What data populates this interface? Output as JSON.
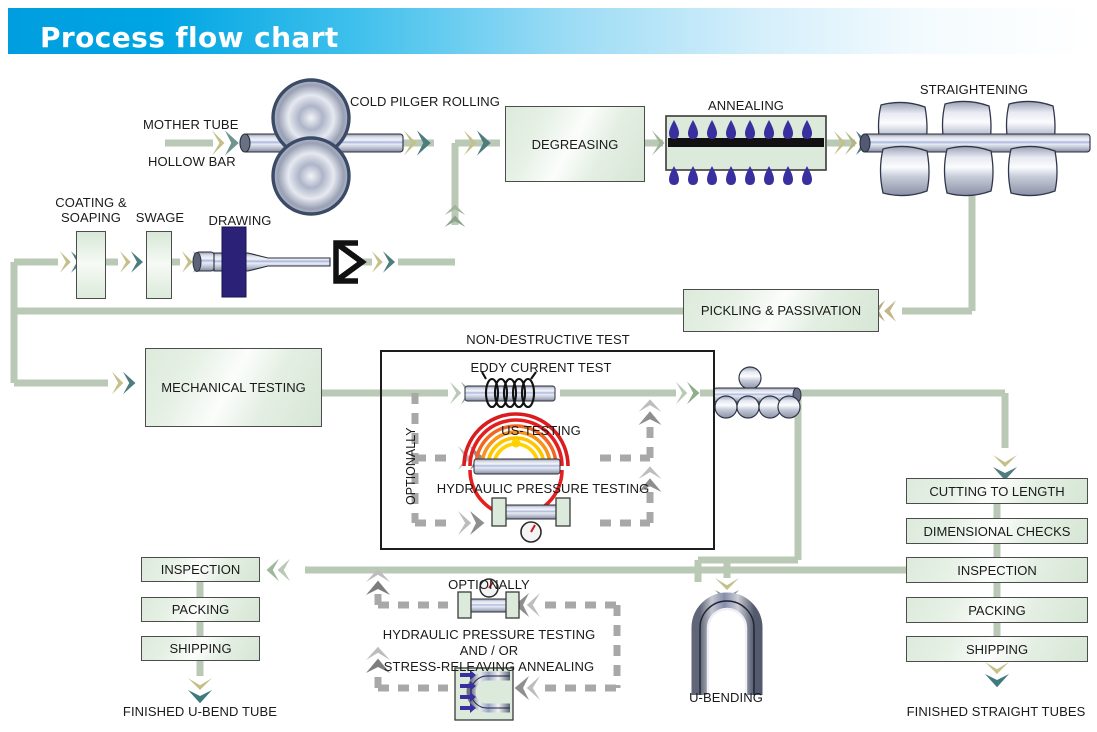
{
  "banner": {
    "title": "Process flow chart"
  },
  "colors": {
    "banner_start": "#009ee0",
    "flow_line": "#b9c9b5",
    "chevron_back": "#c3c08a",
    "chevron_front": "#6e958f",
    "box_border": "#4c4c4c",
    "box_fill": "#e4efe3",
    "dashed_gray": "#a8a8a8",
    "die_blue": "#2b2176",
    "flame_blue": "#3a2f9e",
    "us_wave_red": "#e41f20",
    "us_wave_orange": "#f6941d",
    "us_wave_yellow": "#ffd200",
    "tube_steel": "#aab0c4"
  },
  "stages": {
    "mother_tube": "MOTHER TUBE",
    "hollow_bar": "HOLLOW BAR",
    "cold_pilger_rolling": "COLD PILGER ROLLING",
    "degreasing": "DEGREASING",
    "annealing": "ANNEALING",
    "straightening": "STRAIGHTENING",
    "coating_soaping": "COATING &\nSOAPING",
    "coating_soaping_l1": "COATING &",
    "coating_soaping_l2": "SOAPING",
    "swage": "SWAGE",
    "drawing": "DRAWING",
    "pickling_passivation": "PICKLING & PASSIVATION",
    "mechanical_testing": "MECHANICAL TESTING",
    "non_destructive_test": "NON-DESTRUCTIVE TEST",
    "eddy_current_test": "EDDY CURRENT TEST",
    "us_testing": "US-TESTING",
    "hydraulic_pressure_testing": "HYDRAULIC PRESSURE TESTING",
    "optionally_vertical": "OPTIONALLY",
    "u_bending": "U-BENDING",
    "optionally_bottom": "OPTIONALLY",
    "opt_line1": "HYDRAULIC PRESSURE TESTING",
    "opt_line2": "AND / OR",
    "opt_line3": "STRESS-RELEAVING ANNEALING"
  },
  "right_column": {
    "items": [
      {
        "label": "CUTTING TO LENGTH"
      },
      {
        "label": "DIMENSIONAL CHECKS"
      },
      {
        "label": "INSPECTION"
      },
      {
        "label": "PACKING"
      },
      {
        "label": "SHIPPING"
      }
    ],
    "output": "FINISHED STRAIGHT TUBES"
  },
  "left_column": {
    "items": [
      {
        "label": "INSPECTION"
      },
      {
        "label": "PACKING"
      },
      {
        "label": "SHIPPING"
      }
    ],
    "output": "FINISHED U-BEND TUBE"
  },
  "chart_data": {
    "type": "diagram",
    "title": "Process flow chart",
    "nodes": [
      {
        "id": "mother_tube",
        "label": "MOTHER TUBE",
        "kind": "input-label"
      },
      {
        "id": "hollow_bar",
        "label": "HOLLOW BAR",
        "kind": "input-label"
      },
      {
        "id": "pilger",
        "label": "COLD PILGER ROLLING",
        "kind": "illustration"
      },
      {
        "id": "degreasing",
        "label": "DEGREASING",
        "kind": "process-box"
      },
      {
        "id": "annealing",
        "label": "ANNEALING",
        "kind": "illustration"
      },
      {
        "id": "straightening",
        "label": "STRAIGHTENING",
        "kind": "illustration"
      },
      {
        "id": "pickling",
        "label": "PICKLING & PASSIVATION",
        "kind": "process-box"
      },
      {
        "id": "coating",
        "label": "COATING & SOAPING",
        "kind": "slim-box"
      },
      {
        "id": "swage",
        "label": "SWAGE",
        "kind": "slim-box"
      },
      {
        "id": "drawing",
        "label": "DRAWING",
        "kind": "illustration"
      },
      {
        "id": "mech_test",
        "label": "MECHANICAL TESTING",
        "kind": "process-box"
      },
      {
        "id": "ndt",
        "label": "NON-DESTRUCTIVE TEST",
        "kind": "group"
      },
      {
        "id": "eddy",
        "label": "EDDY CURRENT TEST",
        "kind": "illustration"
      },
      {
        "id": "us",
        "label": "US-TESTING",
        "kind": "illustration"
      },
      {
        "id": "hydro",
        "label": "HYDRAULIC PRESSURE TESTING",
        "kind": "illustration"
      },
      {
        "id": "ubend",
        "label": "U-BENDING",
        "kind": "illustration"
      },
      {
        "id": "cut",
        "label": "CUTTING TO LENGTH",
        "kind": "process-box"
      },
      {
        "id": "dim",
        "label": "DIMENSIONAL CHECKS",
        "kind": "process-box"
      },
      {
        "id": "insp_r",
        "label": "INSPECTION",
        "kind": "process-box"
      },
      {
        "id": "pack_r",
        "label": "PACKING",
        "kind": "process-box"
      },
      {
        "id": "ship_r",
        "label": "SHIPPING",
        "kind": "process-box"
      },
      {
        "id": "out_straight",
        "label": "FINISHED STRAIGHT TUBES",
        "kind": "output"
      },
      {
        "id": "insp_l",
        "label": "INSPECTION",
        "kind": "process-box"
      },
      {
        "id": "pack_l",
        "label": "PACKING",
        "kind": "process-box"
      },
      {
        "id": "ship_l",
        "label": "SHIPPING",
        "kind": "process-box"
      },
      {
        "id": "out_ubend",
        "label": "FINISHED U-BEND TUBE",
        "kind": "output"
      },
      {
        "id": "opt_hydro",
        "label": "HYDRAULIC PRESSURE TESTING",
        "kind": "optional"
      },
      {
        "id": "opt_sra",
        "label": "STRESS-RELEAVING ANNEALING",
        "kind": "optional"
      }
    ],
    "edges": [
      {
        "from": "mother_tube",
        "to": "pilger",
        "style": "solid"
      },
      {
        "from": "pilger",
        "to": "degreasing",
        "style": "solid"
      },
      {
        "from": "degreasing",
        "to": "annealing",
        "style": "solid"
      },
      {
        "from": "annealing",
        "to": "straightening",
        "style": "solid"
      },
      {
        "from": "straightening",
        "to": "pickling",
        "style": "solid"
      },
      {
        "from": "pickling",
        "to": "coating",
        "style": "solid"
      },
      {
        "from": "coating",
        "to": "swage",
        "style": "solid"
      },
      {
        "from": "swage",
        "to": "drawing",
        "style": "solid"
      },
      {
        "from": "drawing",
        "to": "pilger",
        "style": "solid"
      },
      {
        "from": "pickling",
        "to": "mech_test",
        "style": "solid"
      },
      {
        "from": "mech_test",
        "to": "eddy",
        "style": "solid"
      },
      {
        "from": "eddy",
        "to": "us",
        "style": "dashed"
      },
      {
        "from": "eddy",
        "to": "hydro",
        "style": "dashed"
      },
      {
        "from": "ndt",
        "to": "cut",
        "style": "solid"
      },
      {
        "from": "ndt",
        "to": "ubend",
        "style": "solid"
      },
      {
        "from": "cut",
        "to": "dim",
        "style": "solid"
      },
      {
        "from": "dim",
        "to": "insp_r",
        "style": "solid"
      },
      {
        "from": "insp_r",
        "to": "pack_r",
        "style": "solid"
      },
      {
        "from": "pack_r",
        "to": "ship_r",
        "style": "solid"
      },
      {
        "from": "ship_r",
        "to": "out_straight",
        "style": "solid"
      },
      {
        "from": "ubend",
        "to": "opt_hydro",
        "style": "dashed"
      },
      {
        "from": "ubend",
        "to": "opt_sra",
        "style": "dashed"
      },
      {
        "from": "opt_hydro",
        "to": "insp_l",
        "style": "dashed"
      },
      {
        "from": "insp_l",
        "to": "pack_l",
        "style": "solid"
      },
      {
        "from": "pack_l",
        "to": "ship_l",
        "style": "solid"
      },
      {
        "from": "ship_l",
        "to": "out_ubend",
        "style": "solid"
      }
    ]
  }
}
